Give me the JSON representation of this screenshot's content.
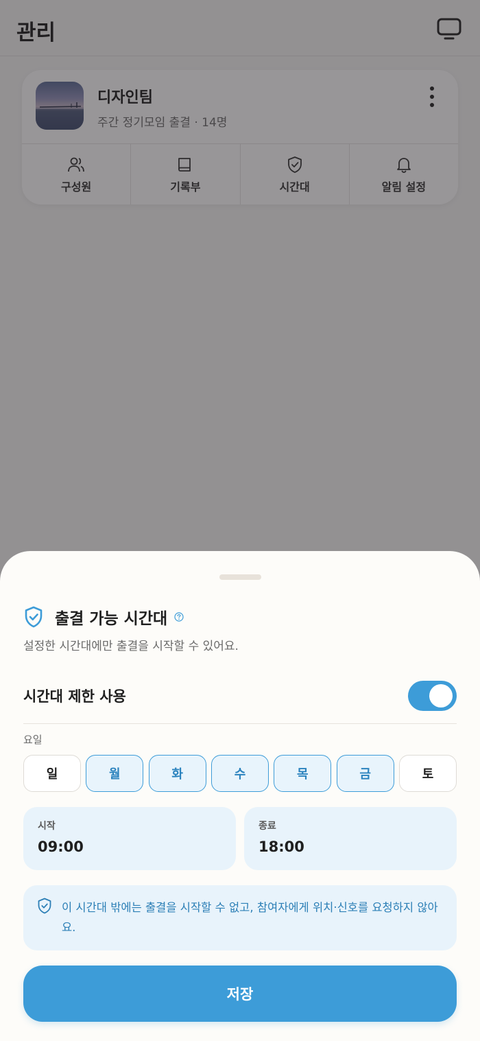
{
  "header": {
    "title": "관리"
  },
  "group": {
    "name": "디자인팀",
    "subtitle": "주간 정기모임 출결 · 14명",
    "tabs": [
      {
        "label": "구성원",
        "icon": "users-icon"
      },
      {
        "label": "기록부",
        "icon": "book-icon"
      },
      {
        "label": "시간대",
        "icon": "shield-check-icon"
      },
      {
        "label": "알림 설정",
        "icon": "bell-icon"
      }
    ]
  },
  "sheet": {
    "title": "출결 가능 시간대",
    "description": "설정한 시간대에만 출결을 시작할 수 있어요.",
    "toggle_label": "시간대 제한 사용",
    "toggle_on": true,
    "days_label": "요일",
    "days": [
      {
        "label": "일",
        "selected": false
      },
      {
        "label": "월",
        "selected": true
      },
      {
        "label": "화",
        "selected": true
      },
      {
        "label": "수",
        "selected": true
      },
      {
        "label": "목",
        "selected": true
      },
      {
        "label": "금",
        "selected": true
      },
      {
        "label": "토",
        "selected": false
      }
    ],
    "start_label": "시작",
    "start_value": "09:00",
    "end_label": "종료",
    "end_value": "18:00",
    "notice": "이 시간대 밖에는 출결을 시작할 수 없고, 참여자에게 위치·신호를 요청하지 않아요.",
    "save_label": "저장"
  },
  "colors": {
    "accent": "#3d9cd8",
    "accent_light": "#e8f3fb",
    "accent_text": "#2b83be"
  }
}
